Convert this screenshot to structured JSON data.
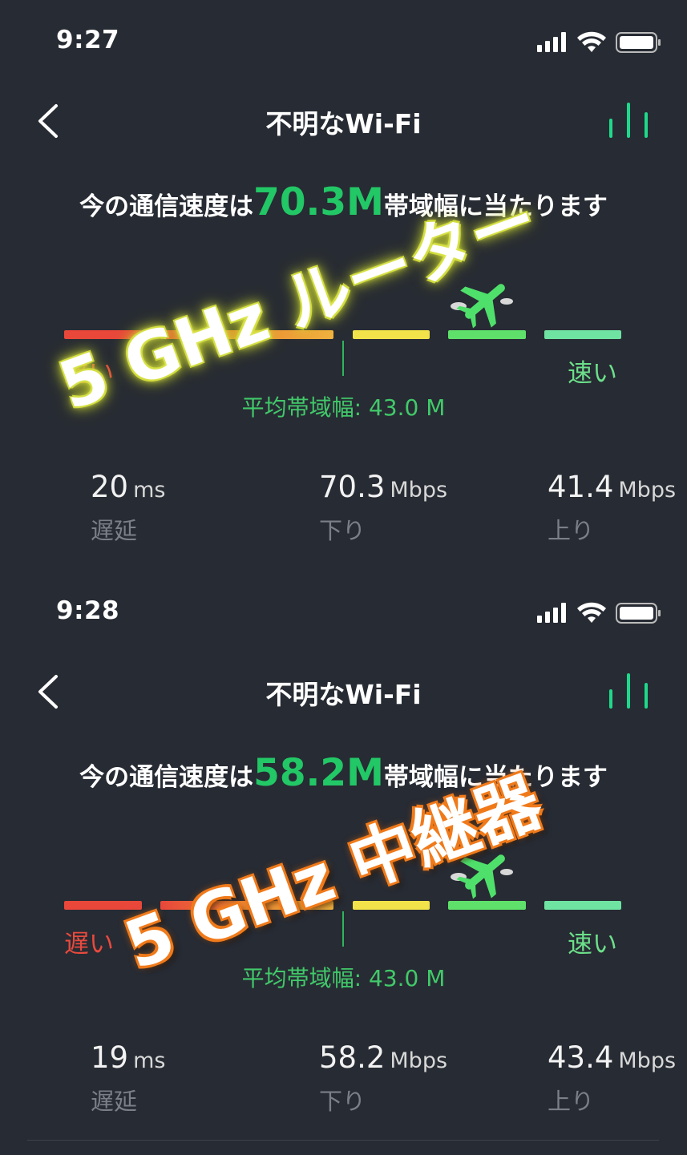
{
  "panels": [
    {
      "status_bar": {
        "time": "9:27",
        "icons": [
          "signal-icon",
          "wifi-icon",
          "battery-icon"
        ]
      },
      "header": {
        "title": "不明なWi-Fi",
        "back_icon": "chevron-left-icon",
        "stats_icon": "bar-chart-icon"
      },
      "headline": {
        "prefix": "今の通信速度は",
        "speed": "70.3M",
        "suffix": "帯域幅に当たります"
      },
      "gauge": {
        "slow_label": "遅い",
        "fast_label": "速い",
        "average": "平均帯域幅: 43.0 M",
        "segment_colors": [
          "#e8473a",
          "#ec8a35",
          "#f2e34a",
          "#5fe06a",
          "#6fe3a2"
        ],
        "indicator_icon": "airplane-icon"
      },
      "metrics": [
        {
          "value": "20",
          "unit": "ms",
          "label": "遅延"
        },
        {
          "value": "70.3",
          "unit": "Mbps",
          "label": "下り"
        },
        {
          "value": "41.4",
          "unit": "Mbps",
          "label": "上り"
        }
      ],
      "overlay_caption": "5 GHz ルーター"
    },
    {
      "status_bar": {
        "time": "9:28",
        "icons": [
          "signal-icon",
          "wifi-icon",
          "battery-icon"
        ]
      },
      "header": {
        "title": "不明なWi-Fi",
        "back_icon": "chevron-left-icon",
        "stats_icon": "bar-chart-icon"
      },
      "headline": {
        "prefix": "今の通信速度は",
        "speed": "58.2M",
        "suffix": "帯域幅に当たります"
      },
      "gauge": {
        "slow_label": "遅い",
        "fast_label": "速い",
        "average": "平均帯域幅: 43.0 M",
        "segment_colors": [
          "#e8473a",
          "#ec8a35",
          "#f2e34a",
          "#5fe06a",
          "#6fe3a2"
        ],
        "indicator_icon": "airplane-icon"
      },
      "metrics": [
        {
          "value": "19",
          "unit": "ms",
          "label": "遅延"
        },
        {
          "value": "58.2",
          "unit": "Mbps",
          "label": "下り"
        },
        {
          "value": "43.4",
          "unit": "Mbps",
          "label": "上り"
        }
      ],
      "overlay_caption": "5 GHz 中継器"
    }
  ],
  "colors": {
    "background": "#272b33",
    "accent": "#22c766",
    "slow": "#e84a3e",
    "fast": "#6ce08a"
  }
}
